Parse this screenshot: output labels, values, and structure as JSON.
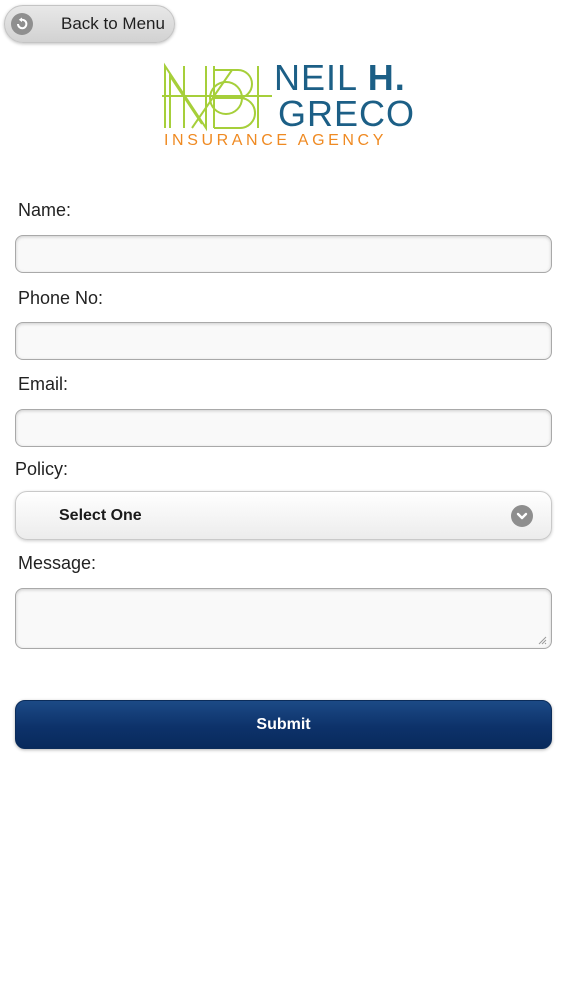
{
  "header": {
    "back_label": "Back to Menu",
    "back_icon": "arrow-back-icon"
  },
  "logo": {
    "name_first": "NEIL",
    "name_initial": "H.",
    "name_last": "GRECO",
    "tagline": "INSURANCE AGENCY",
    "colors": {
      "monogram": "#a6cf3a",
      "name": "#1c5f86",
      "tagline": "#ef8a22"
    }
  },
  "form": {
    "name_label": "Name:",
    "name_value": "",
    "phone_label": "Phone No:",
    "phone_value": "",
    "email_label": "Email:",
    "email_value": "",
    "policy_label": "Policy:",
    "policy_selected": "Select One",
    "policy_icon": "chevron-down-icon",
    "message_label": "Message:",
    "message_value": "",
    "submit_label": "Submit"
  },
  "colors": {
    "submit_bg": "#0d326a",
    "page_bg": "#ffffff"
  }
}
